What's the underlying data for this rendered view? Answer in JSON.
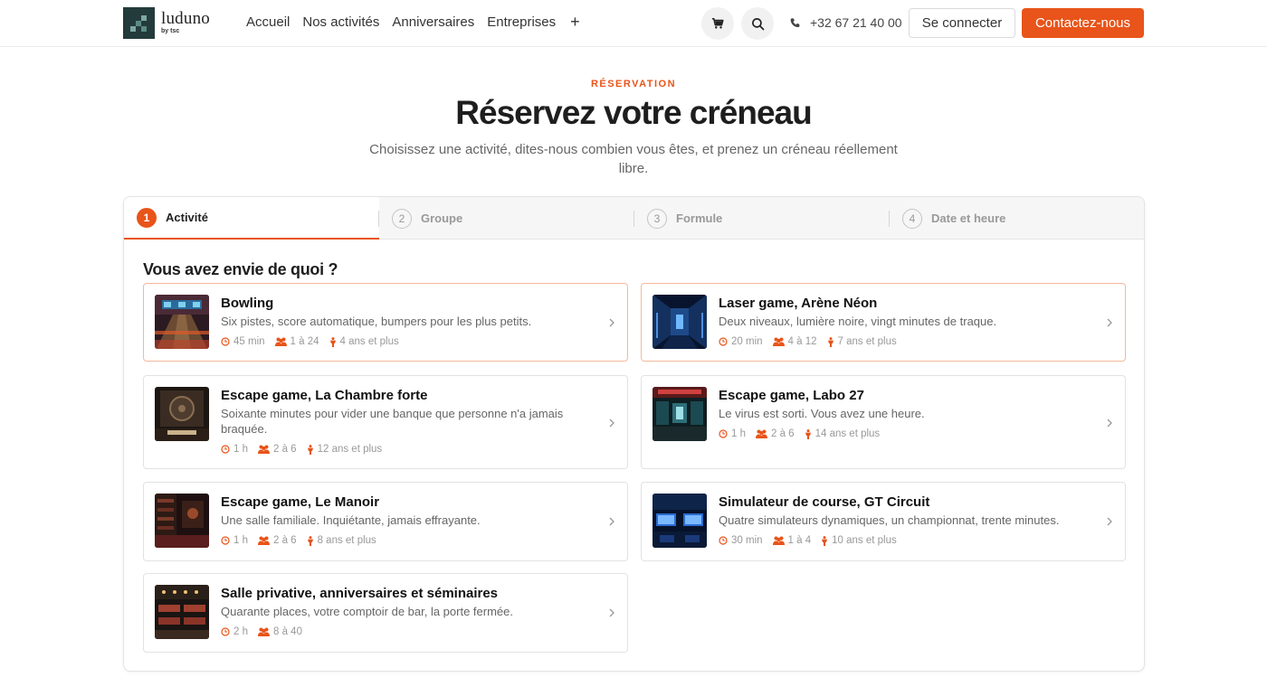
{
  "brand": {
    "name": "luduno",
    "sub": "by tsc"
  },
  "nav": {
    "items": [
      "Accueil",
      "Nos activités",
      "Anniversaires",
      "Entreprises"
    ],
    "more": "+"
  },
  "header": {
    "phone": "+32 67 21 40 00",
    "login": "Se connecter",
    "contact": "Contactez-nous"
  },
  "hero": {
    "eyebrow": "RÉSERVATION",
    "title": "Réservez votre créneau",
    "subtitle": "Choisissez une activité, dites-nous combien vous êtes, et prenez un créneau réellement libre."
  },
  "steps": [
    {
      "num": "1",
      "label": "Activité",
      "active": true
    },
    {
      "num": "2",
      "label": "Groupe",
      "active": false
    },
    {
      "num": "3",
      "label": "Formule",
      "active": false
    },
    {
      "num": "4",
      "label": "Date et heure",
      "active": false
    }
  ],
  "question": "Vous avez envie de quoi ?",
  "activities": [
    {
      "name": "Bowling",
      "desc": "Six pistes, score automatique, bumpers pour les plus petits.",
      "duration": "45 min",
      "group": "1 à 24",
      "age": "4 ans et plus"
    },
    {
      "name": "Laser game, Arène Néon",
      "desc": "Deux niveaux, lumière noire, vingt minutes de traque.",
      "duration": "20 min",
      "group": "4 à 12",
      "age": "7 ans et plus"
    },
    {
      "name": "Escape game, La Chambre forte",
      "desc": "Soixante minutes pour vider une banque que personne n'a jamais braquée.",
      "duration": "1 h",
      "group": "2 à 6",
      "age": "12 ans et plus"
    },
    {
      "name": "Escape game, Labo 27",
      "desc": "Le virus est sorti. Vous avez une heure.",
      "duration": "1 h",
      "group": "2 à 6",
      "age": "14 ans et plus"
    },
    {
      "name": "Escape game, Le Manoir",
      "desc": "Une salle familiale. Inquiétante, jamais effrayante.",
      "duration": "1 h",
      "group": "2 à 6",
      "age": "8 ans et plus"
    },
    {
      "name": "Simulateur de course, GT Circuit",
      "desc": "Quatre simulateurs dynamiques, un championnat, trente minutes.",
      "duration": "30 min",
      "group": "1 à 4",
      "age": "10 ans et plus"
    },
    {
      "name": "Salle privative, anniversaires et séminaires",
      "desc": "Quarante places, votre comptoir de bar, la porte fermée.",
      "duration": "2 h",
      "group": "8 à 40",
      "age": null
    }
  ],
  "colors": {
    "accent": "#e8541a",
    "brand_dark": "#233b3b"
  },
  "icons": {
    "cart": "cart-icon",
    "search": "search-icon",
    "phone": "phone-icon",
    "clock": "clock-icon",
    "group": "group-icon",
    "age": "person-icon",
    "chevron": "chevron-right-icon"
  }
}
